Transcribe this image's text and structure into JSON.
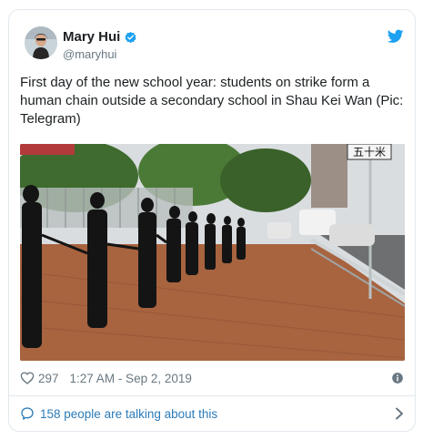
{
  "author": {
    "name": "Mary Hui",
    "handle": "@maryhui",
    "verified": true
  },
  "tweet": {
    "text": "First day of the new school year: students on strike form a human chain outside a secondary school in Shau Kei Wan (Pic: Telegram)"
  },
  "media": {
    "street_sign": "五十米"
  },
  "meta": {
    "likes": "297",
    "timestamp": "1:27 AM - Sep 2, 2019"
  },
  "footer": {
    "talking_label": "158 people are talking about this"
  },
  "icons": {
    "brand": "twitter-bird-icon",
    "verified": "verified-badge-icon",
    "like": "heart-icon",
    "info": "info-icon",
    "reply": "speech-bubble-icon",
    "more": "chevron-right-icon"
  },
  "colors": {
    "twitter_blue": "#1da1f2",
    "link_blue": "#2b7bb9",
    "muted_gray": "#697882",
    "border": "#e1e8ed"
  }
}
